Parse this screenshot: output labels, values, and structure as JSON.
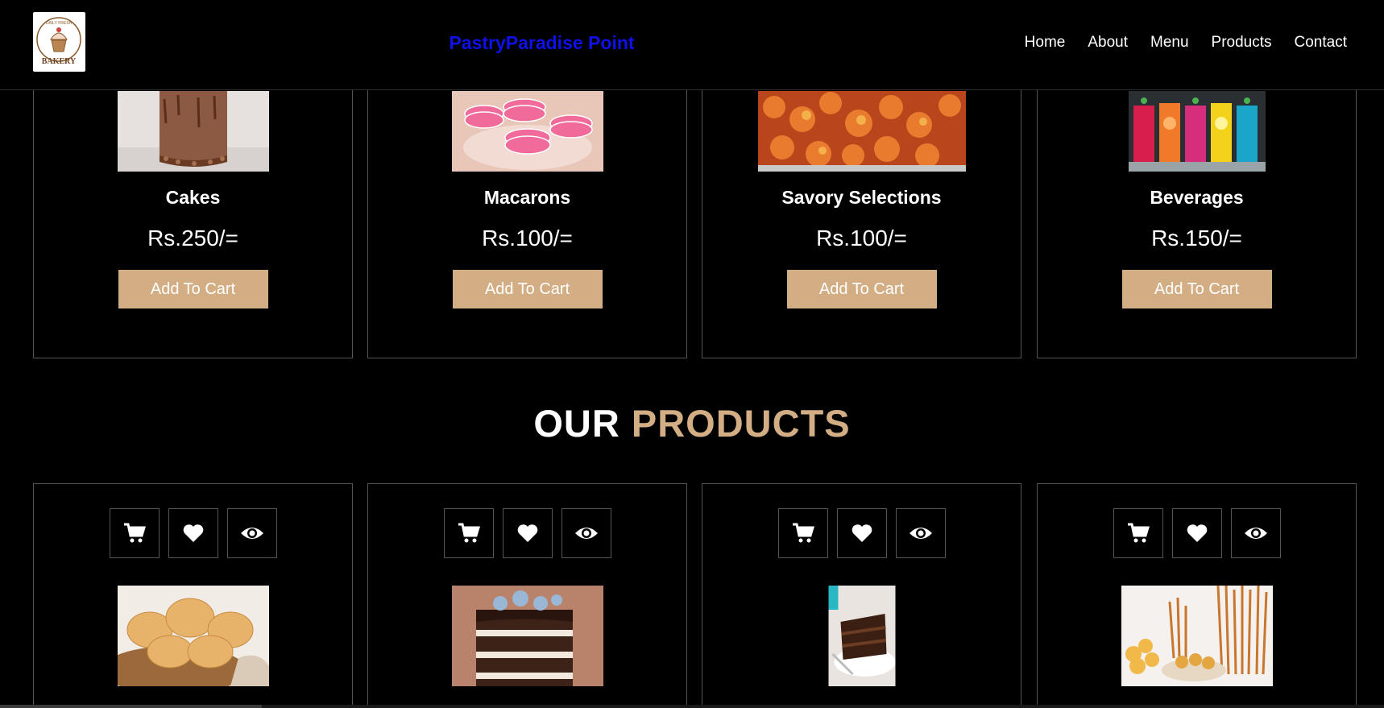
{
  "header": {
    "brand": "PastryParadise Point",
    "nav": [
      "Home",
      "About",
      "Menu",
      "Products",
      "Contact"
    ],
    "logo": {
      "top_text": "DAILY FRESH",
      "bottom_text": "BAKERY"
    }
  },
  "menu_items": [
    {
      "title": "Cakes",
      "price": "Rs.250/=",
      "button": "Add To Cart",
      "image": "chocolate-cake-image"
    },
    {
      "title": "Macarons",
      "price": "Rs.100/=",
      "button": "Add To Cart",
      "image": "pink-macarons-image"
    },
    {
      "title": "Savory Selections",
      "price": "Rs.100/=",
      "button": "Add To Cart",
      "image": "savory-shrimp-image"
    },
    {
      "title": "Beverages",
      "price": "Rs.150/=",
      "button": "Add To Cart",
      "image": "colorful-drinks-image"
    }
  ],
  "products_heading": {
    "main": "OUR",
    "accent": "PRODUCTS"
  },
  "products": [
    {
      "image": "bread-rolls-image",
      "icons": [
        "cart-icon",
        "heart-icon",
        "eye-icon"
      ]
    },
    {
      "image": "layer-cake-image",
      "icons": [
        "cart-icon",
        "heart-icon",
        "eye-icon"
      ]
    },
    {
      "image": "chocolate-slice-image",
      "icons": [
        "cart-icon",
        "heart-icon",
        "eye-icon"
      ]
    },
    {
      "image": "snacks-pretzels-image",
      "icons": [
        "cart-icon",
        "heart-icon",
        "eye-icon"
      ]
    }
  ],
  "colors": {
    "accent": "#d3ae84",
    "brand": "#1010e8",
    "background": "#000000",
    "border": "#555555"
  }
}
